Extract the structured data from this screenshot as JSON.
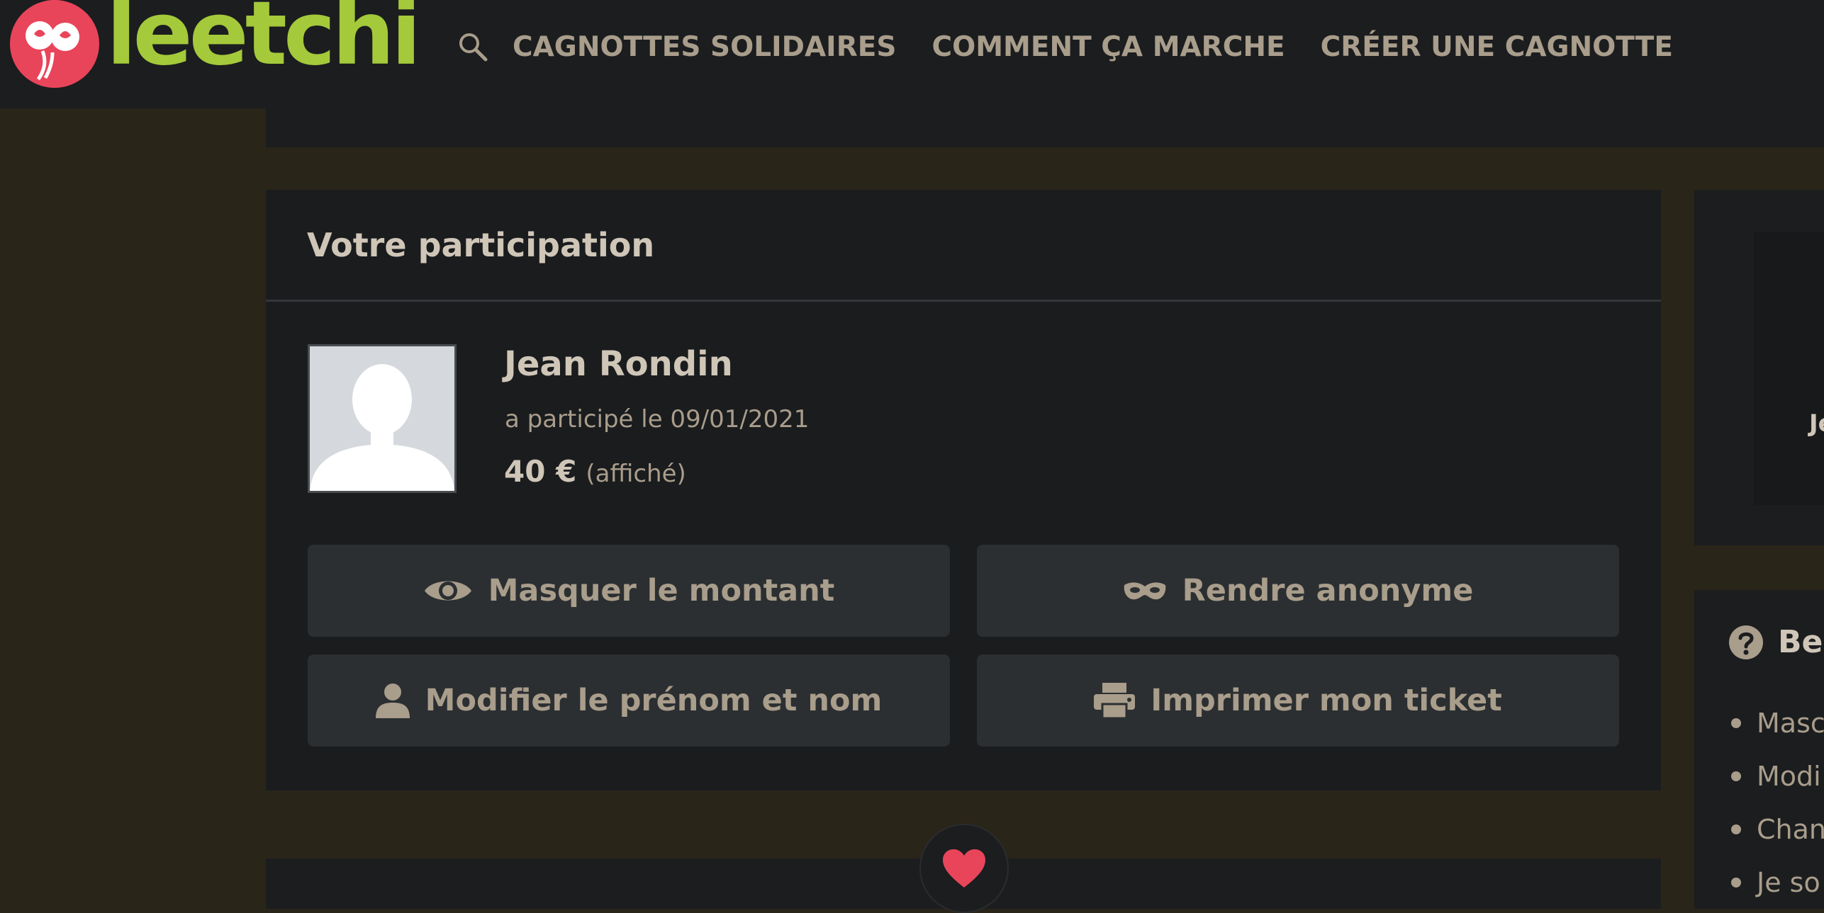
{
  "header": {
    "logo_text": "leetchi",
    "nav": [
      {
        "label": "CAGNOTTES SOLIDAIRES"
      },
      {
        "label": "COMMENT ÇA MARCHE"
      },
      {
        "label": "CRÉER UNE CAGNOTTE"
      }
    ]
  },
  "participation": {
    "title": "Votre participation",
    "name": "Jean Rondin",
    "date_text": "a participé le 09/01/2021",
    "amount": "40 €",
    "amount_status": "(affiché)",
    "buttons": {
      "hide_amount": "Masquer le montant",
      "anonymize": "Rendre anonyme",
      "edit_name": "Modifier le prénom et nom",
      "print_ticket": "Imprimer mon ticket"
    }
  },
  "sidebar": {
    "card_fragment": "Je",
    "help_title": "Bes",
    "help_items": [
      "Masc",
      "Modi",
      "Chan",
      "Je so"
    ]
  },
  "colors": {
    "accent_green": "#a4c93a",
    "logo_red": "#e8455a",
    "heart_red": "#e8455a",
    "text_muted": "#a99d8b",
    "text_light": "#cfc6b8"
  }
}
